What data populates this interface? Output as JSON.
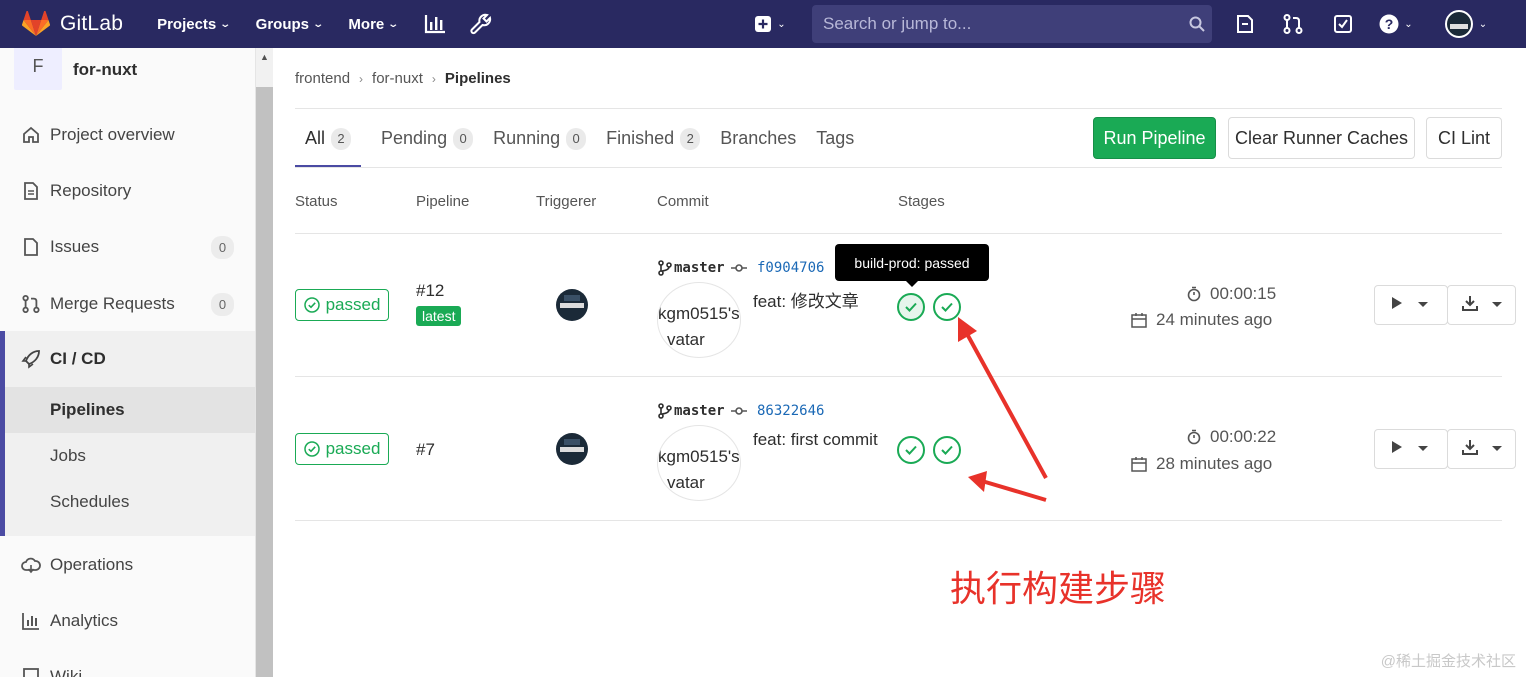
{
  "topnav": {
    "app_name": "GitLab",
    "menu": [
      "Projects",
      "Groups",
      "More"
    ],
    "search_placeholder": "Search or jump to..."
  },
  "sidebar": {
    "project_initial": "F",
    "project_name": "for-nuxt",
    "items": [
      {
        "label": "Project overview"
      },
      {
        "label": "Repository"
      },
      {
        "label": "Issues",
        "count": "0"
      },
      {
        "label": "Merge Requests",
        "count": "0"
      }
    ],
    "cicd": {
      "label": "CI / CD",
      "subitems": [
        "Pipelines",
        "Jobs",
        "Schedules"
      ]
    },
    "after": [
      {
        "label": "Operations"
      },
      {
        "label": "Analytics"
      },
      {
        "label": "Wiki"
      }
    ]
  },
  "breadcrumb": [
    "frontend",
    "for-nuxt",
    "Pipelines"
  ],
  "tabs": [
    {
      "label": "All",
      "count": "2"
    },
    {
      "label": "Pending",
      "count": "0"
    },
    {
      "label": "Running",
      "count": "0"
    },
    {
      "label": "Finished",
      "count": "2"
    },
    {
      "label": "Branches"
    },
    {
      "label": "Tags"
    }
  ],
  "buttons": {
    "run_pipeline": "Run Pipeline",
    "clear_caches": "Clear Runner Caches",
    "ci_lint": "CI Lint"
  },
  "table": {
    "headers": [
      "Status",
      "Pipeline",
      "Triggerer",
      "Commit",
      "Stages"
    ],
    "rows": [
      {
        "status": "passed",
        "pipeline_id": "#12",
        "tag": "latest",
        "branch": "master",
        "sha": "f0904706",
        "avatar_alt_lines": [
          "kgm0515's",
          "vatar"
        ],
        "commit_title": "feat: 修改文章",
        "duration": "00:00:15",
        "finished": "24 minutes ago"
      },
      {
        "status": "passed",
        "pipeline_id": "#7",
        "tag": "",
        "branch": "master",
        "sha": "86322646",
        "avatar_alt_lines": [
          "kgm0515's",
          "vatar"
        ],
        "commit_title": "feat: first commit",
        "duration": "00:00:22",
        "finished": "28 minutes ago"
      }
    ]
  },
  "tooltip": "build-prod: passed",
  "annotation": "执行构建步骤",
  "watermark": "@稀土掘金技术社区",
  "colors": {
    "nav_bg": "#292961",
    "accent": "#4b4ba3",
    "success": "#1aaa55",
    "link": "#1b69b6",
    "annotation": "#e8322a"
  }
}
